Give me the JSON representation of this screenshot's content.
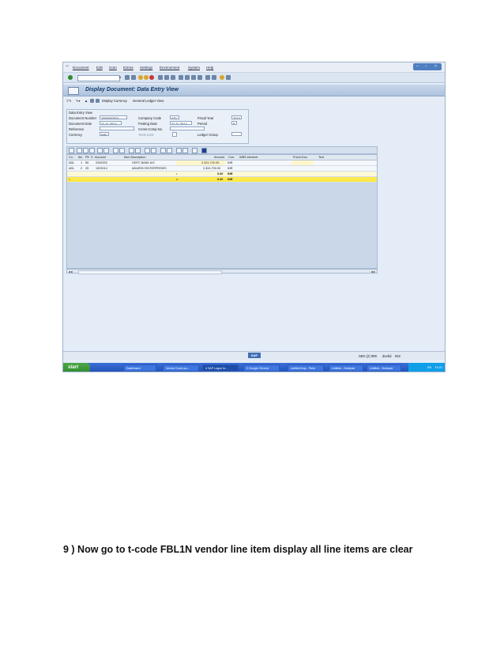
{
  "menu": [
    "Document",
    "Edit",
    "Goto",
    "Extras",
    "Settings",
    "Environment",
    "System",
    "Help"
  ],
  "title": "Display Document: Data Entry View",
  "app_toolbar": {
    "display_currency": "Display Currency",
    "general_ledger_view": "General Ledger View"
  },
  "header": {
    "group_title": "Data Entry View",
    "document_number_label": "Document Number",
    "document_number": "1500000524",
    "company_code_label": "Company Code",
    "company_code": "ADL",
    "fiscal_year_label": "Fiscal Year",
    "fiscal_year": "2014",
    "document_date_label": "Document Date",
    "document_date": "21.11.2014",
    "posting_date_label": "Posting Date",
    "posting_date": "21.11.2014",
    "period_label": "Period",
    "period": "8",
    "reference_label": "Reference",
    "cross_comp_label": "Cross-Comp.No.",
    "currency_label": "Currency",
    "currency": "INR",
    "texts_exist_label": "Texts exist",
    "ledger_group_label": "Ledger Group"
  },
  "grid": {
    "columns": [
      "Co..",
      "Itm",
      "PK",
      "S",
      "Account",
      "Item Description",
      "",
      "Amount",
      "Curr.",
      "WBS element",
      "Purch.Doc.",
      "Text"
    ],
    "rows": [
      {
        "co": "ADL",
        "itm": "1",
        "pk": "50",
        "s": "",
        "account": "2262000",
        "desc": "HDFC BANK A/C",
        "amount": "2,324,700.00-",
        "curr": "INR"
      },
      {
        "co": "ADL",
        "itm": "2",
        "pk": "25",
        "s": "",
        "account": "1003014",
        "desc": "ADARSH ENTERPRISES",
        "amount": "2,324,700.00",
        "curr": "INR"
      }
    ],
    "subtotal": {
      "marker": "•",
      "amount": "0.00",
      "curr": "INR"
    },
    "total": {
      "marker": "••",
      "amount": "0.00",
      "curr": "INR"
    }
  },
  "status": {
    "system": "SBX (2) 909",
    "server": "devbd",
    "mode": "INS"
  },
  "taskbar": {
    "start": "start",
    "tasks": [
      "Dashboard",
      "Vendor Down pa...",
      "4 SAP Logon fo...",
      "2 Google Chrome",
      "untitled.bmp - Paint",
      "Untitled - Notepad",
      "Untitled - Notepad"
    ],
    "clock": "19:21",
    "lang": "EN"
  },
  "instruction": "9 ) Now go to t-code  FBL1N vendor line item display  all  line items  are clear"
}
